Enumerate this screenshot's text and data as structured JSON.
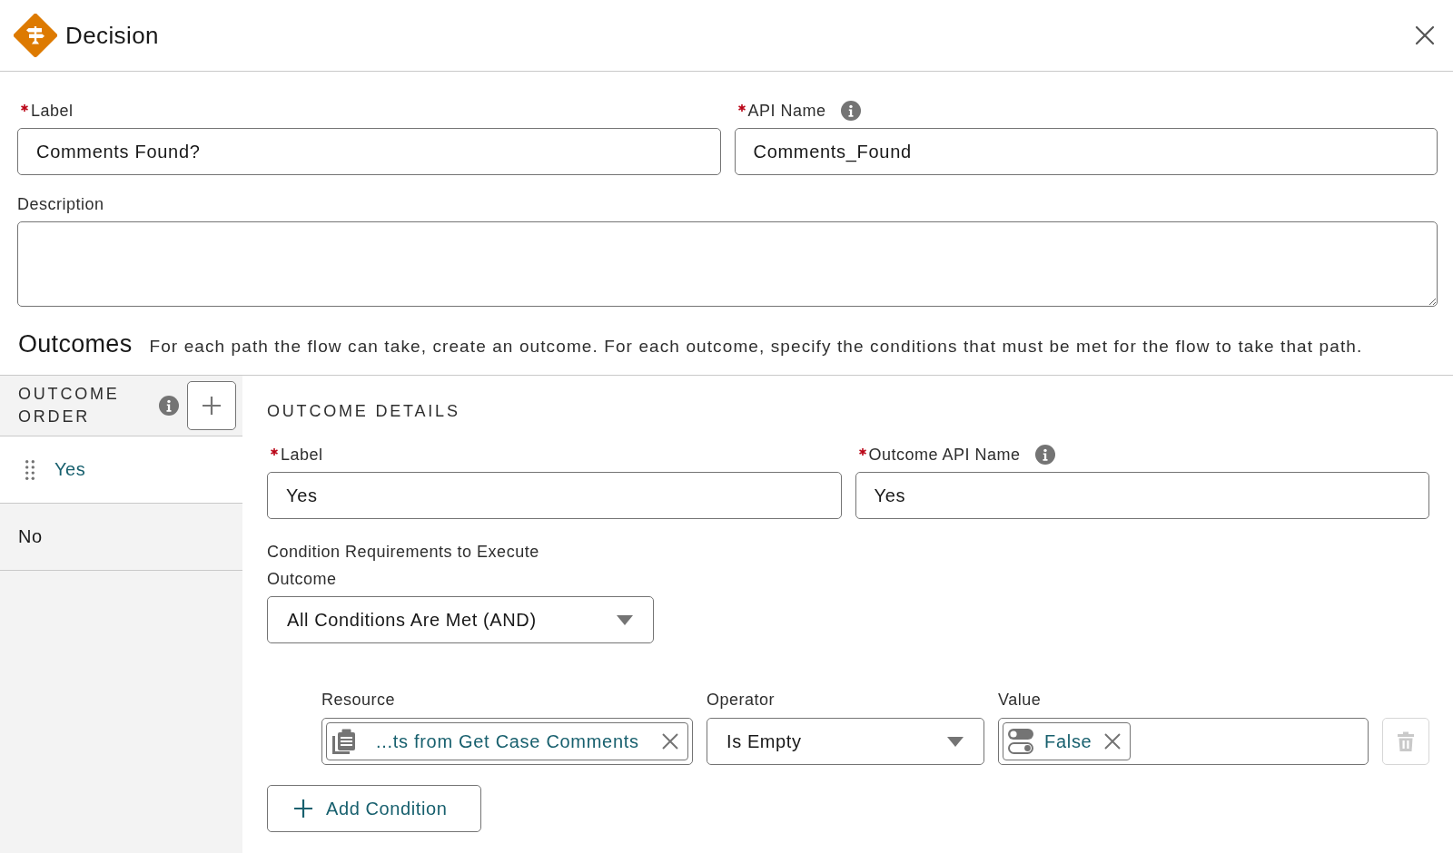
{
  "window": {
    "title": "Decision"
  },
  "fields": [
    {
      "label": "Label",
      "required": true,
      "info": false,
      "value": "Comments Found?"
    },
    {
      "label": "API Name",
      "required": true,
      "info": true,
      "value": "Comments_Found"
    }
  ],
  "description": {
    "label": "Description"
  },
  "outcomes": {
    "title": "Outcomes",
    "help": "For each path the flow can take, create an outcome. For each outcome, specify the conditions that must be met for the flow to take that path."
  },
  "outcome_order": {
    "title": "OUTCOME ORDER",
    "info": true,
    "items": [
      {
        "label": "Yes",
        "selected": true
      },
      {
        "label": "No",
        "selected": false
      }
    ]
  },
  "outcome_details": {
    "title": "OUTCOME DETAILS",
    "fields": [
      {
        "label": "Label",
        "required": true,
        "info": false,
        "value": "Yes"
      },
      {
        "label": "Outcome API Name",
        "required": true,
        "info": true,
        "value": "Yes"
      }
    ],
    "condition_logic": {
      "label": "Condition Requirements to Execute Outcome",
      "value": "All Conditions Are Met (AND)"
    },
    "columns": [
      "Resource",
      "Operator",
      "Value"
    ],
    "conditions": [
      {
        "resource": "...ts from Get Case Comments",
        "operator": "Is Empty",
        "value": "False",
        "delete_disabled": true
      }
    ],
    "add_button": "Add Condition"
  }
}
